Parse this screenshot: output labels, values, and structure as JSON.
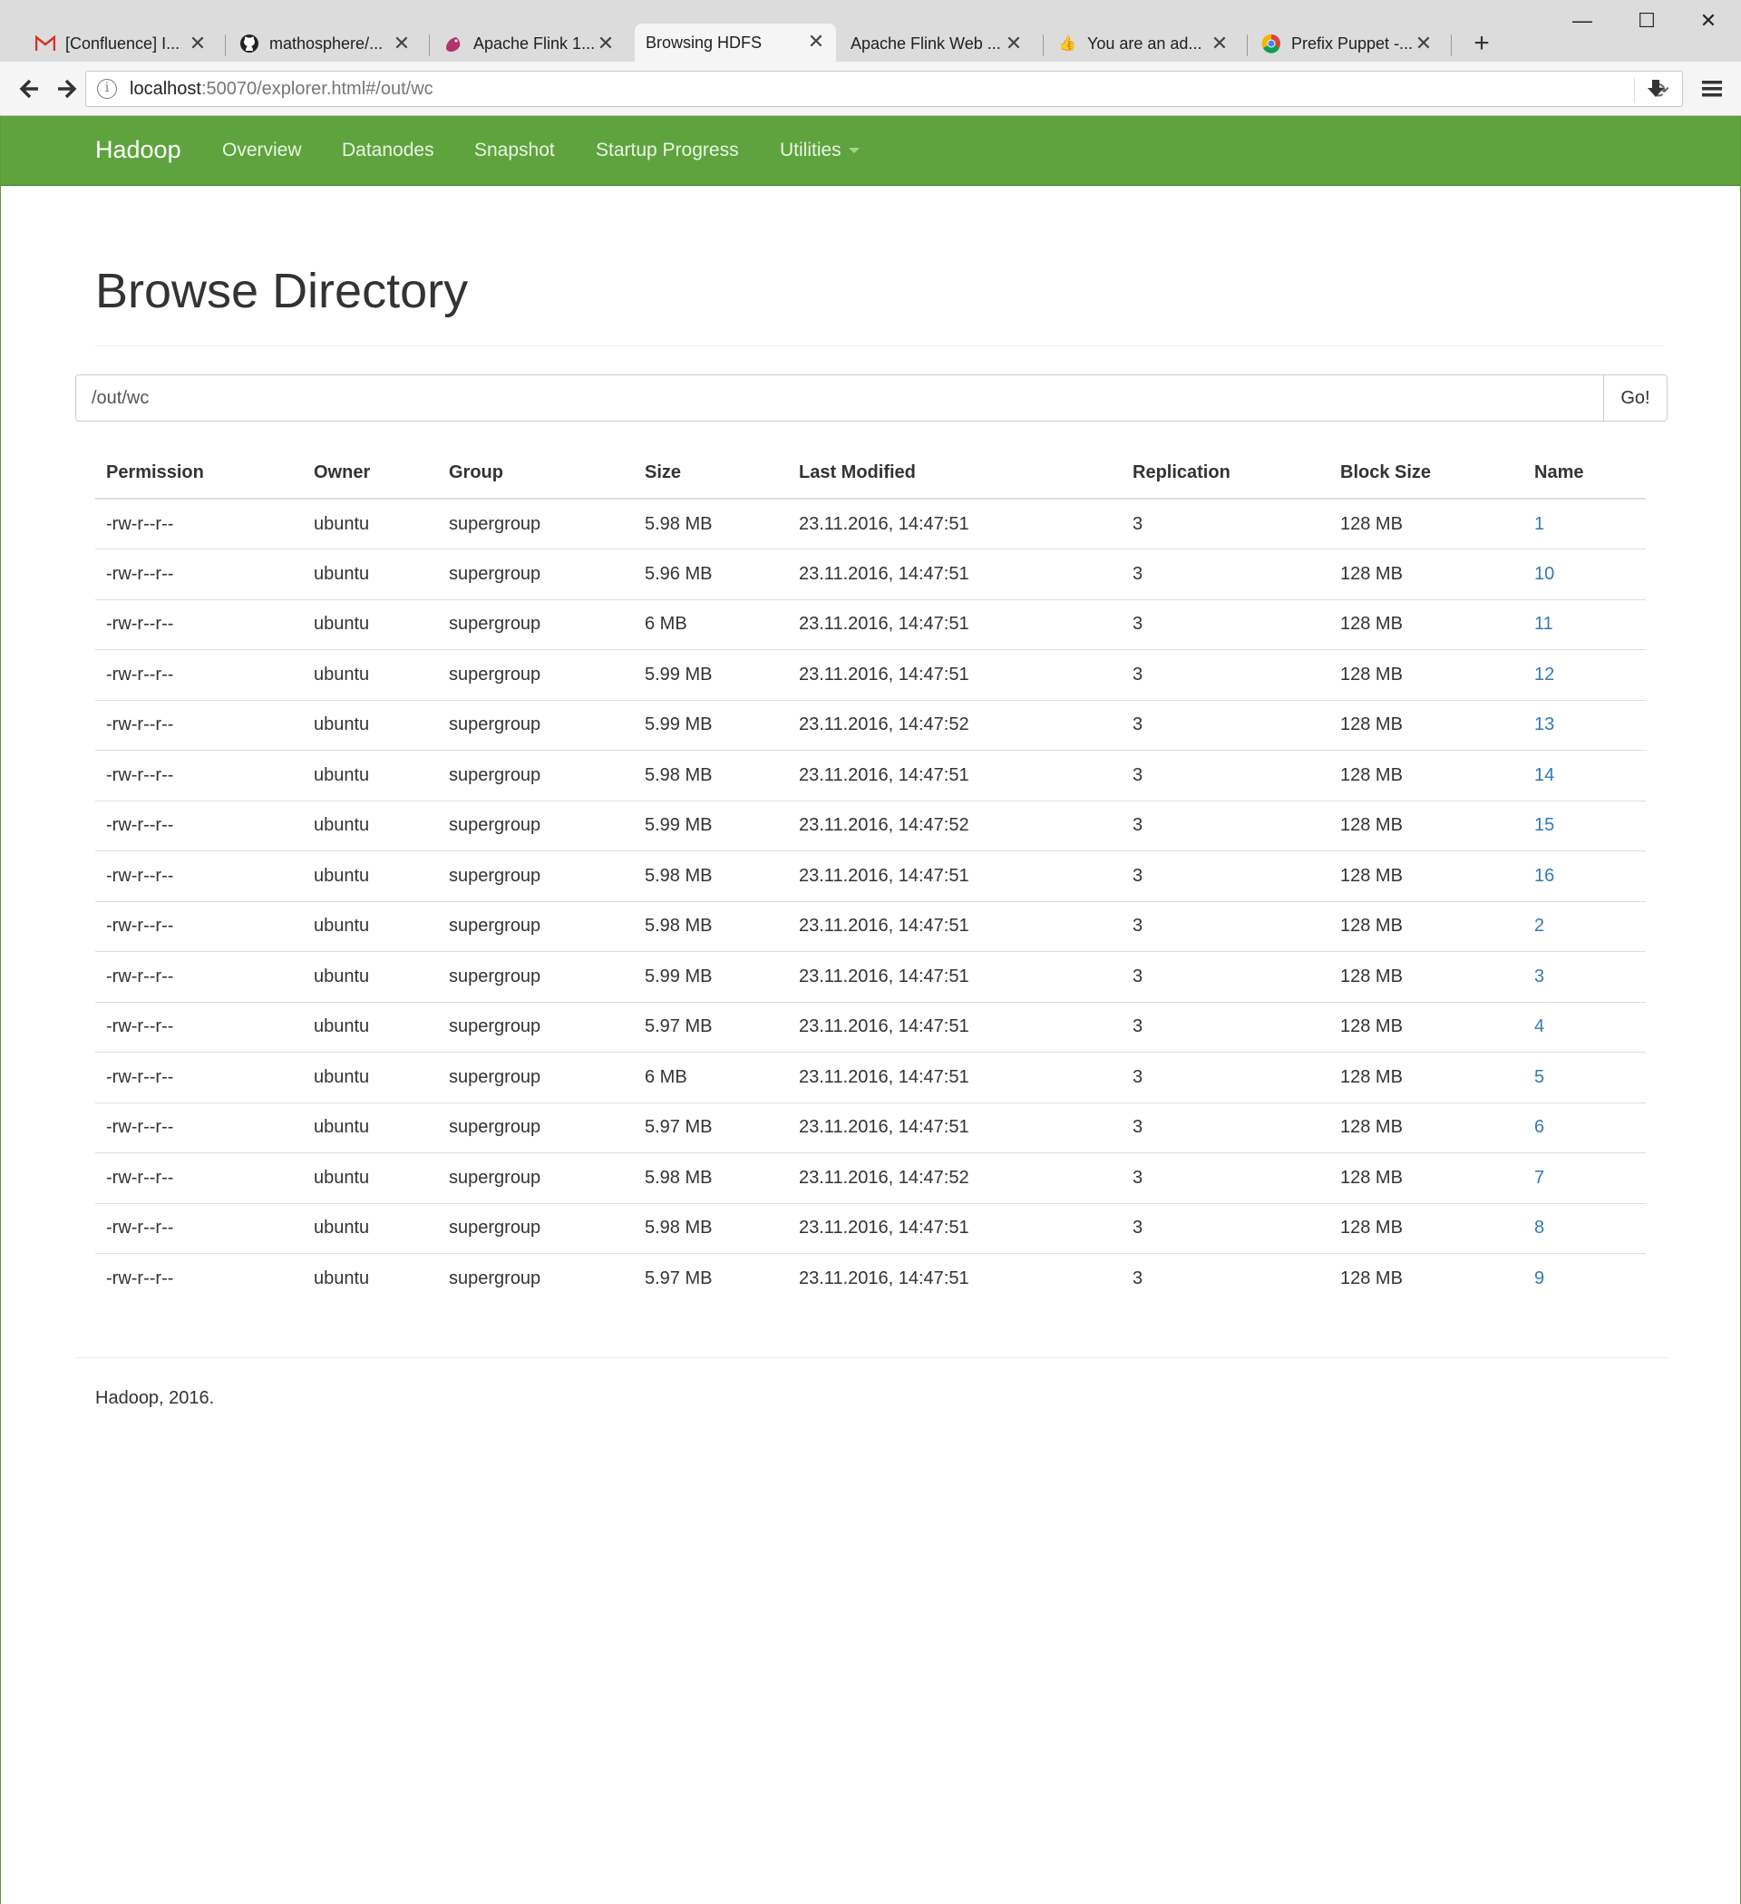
{
  "browser": {
    "tabs": [
      {
        "title": "[Confluence] I...",
        "icon": "gmail-icon",
        "active": false
      },
      {
        "title": "mathosphere/...",
        "icon": "github-icon",
        "active": false
      },
      {
        "title": "Apache Flink 1...",
        "icon": "flink-icon",
        "active": false
      },
      {
        "title": "Browsing HDFS",
        "icon": "",
        "active": true
      },
      {
        "title": "Apache Flink Web ...",
        "icon": "",
        "active": false
      },
      {
        "title": "You are an ad...",
        "icon": "thumbs-up-icon",
        "active": false
      },
      {
        "title": "Prefix Puppet -...",
        "icon": "chrome-icon",
        "active": false
      }
    ],
    "url_host": "localhost",
    "url_rest": ":50070/explorer.html#/out/wc"
  },
  "navbar": {
    "brand": "Hadoop",
    "items": [
      "Overview",
      "Datanodes",
      "Snapshot",
      "Startup Progress",
      "Utilities"
    ],
    "color": "#5fa33e"
  },
  "page": {
    "title": "Browse Directory",
    "path_value": "/out/wc",
    "go_label": "Go!",
    "footer": "Hadoop, 2016."
  },
  "table": {
    "headers": [
      "Permission",
      "Owner",
      "Group",
      "Size",
      "Last Modified",
      "Replication",
      "Block Size",
      "Name"
    ],
    "rows": [
      [
        "-rw-r--r--",
        "ubuntu",
        "supergroup",
        "5.98 MB",
        "23.11.2016, 14:47:51",
        "3",
        "128 MB",
        "1"
      ],
      [
        "-rw-r--r--",
        "ubuntu",
        "supergroup",
        "5.96 MB",
        "23.11.2016, 14:47:51",
        "3",
        "128 MB",
        "10"
      ],
      [
        "-rw-r--r--",
        "ubuntu",
        "supergroup",
        "6 MB",
        "23.11.2016, 14:47:51",
        "3",
        "128 MB",
        "11"
      ],
      [
        "-rw-r--r--",
        "ubuntu",
        "supergroup",
        "5.99 MB",
        "23.11.2016, 14:47:51",
        "3",
        "128 MB",
        "12"
      ],
      [
        "-rw-r--r--",
        "ubuntu",
        "supergroup",
        "5.99 MB",
        "23.11.2016, 14:47:52",
        "3",
        "128 MB",
        "13"
      ],
      [
        "-rw-r--r--",
        "ubuntu",
        "supergroup",
        "5.98 MB",
        "23.11.2016, 14:47:51",
        "3",
        "128 MB",
        "14"
      ],
      [
        "-rw-r--r--",
        "ubuntu",
        "supergroup",
        "5.99 MB",
        "23.11.2016, 14:47:52",
        "3",
        "128 MB",
        "15"
      ],
      [
        "-rw-r--r--",
        "ubuntu",
        "supergroup",
        "5.98 MB",
        "23.11.2016, 14:47:51",
        "3",
        "128 MB",
        "16"
      ],
      [
        "-rw-r--r--",
        "ubuntu",
        "supergroup",
        "5.98 MB",
        "23.11.2016, 14:47:51",
        "3",
        "128 MB",
        "2"
      ],
      [
        "-rw-r--r--",
        "ubuntu",
        "supergroup",
        "5.99 MB",
        "23.11.2016, 14:47:51",
        "3",
        "128 MB",
        "3"
      ],
      [
        "-rw-r--r--",
        "ubuntu",
        "supergroup",
        "5.97 MB",
        "23.11.2016, 14:47:51",
        "3",
        "128 MB",
        "4"
      ],
      [
        "-rw-r--r--",
        "ubuntu",
        "supergroup",
        "6 MB",
        "23.11.2016, 14:47:51",
        "3",
        "128 MB",
        "5"
      ],
      [
        "-rw-r--r--",
        "ubuntu",
        "supergroup",
        "5.97 MB",
        "23.11.2016, 14:47:51",
        "3",
        "128 MB",
        "6"
      ],
      [
        "-rw-r--r--",
        "ubuntu",
        "supergroup",
        "5.98 MB",
        "23.11.2016, 14:47:52",
        "3",
        "128 MB",
        "7"
      ],
      [
        "-rw-r--r--",
        "ubuntu",
        "supergroup",
        "5.98 MB",
        "23.11.2016, 14:47:51",
        "3",
        "128 MB",
        "8"
      ],
      [
        "-rw-r--r--",
        "ubuntu",
        "supergroup",
        "5.97 MB",
        "23.11.2016, 14:47:51",
        "3",
        "128 MB",
        "9"
      ]
    ]
  }
}
